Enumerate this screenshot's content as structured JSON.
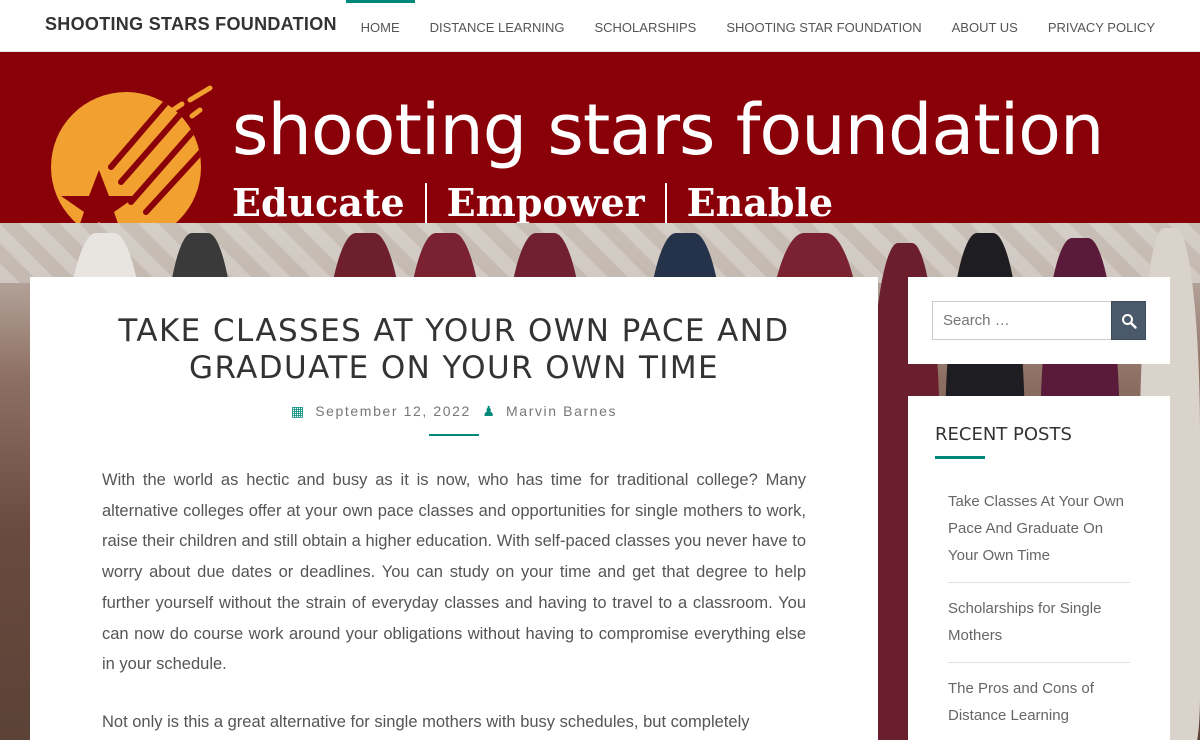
{
  "site": {
    "title": "SHOOTING STARS FOUNDATION"
  },
  "nav": {
    "items": [
      {
        "label": "HOME",
        "active": true
      },
      {
        "label": "DISTANCE LEARNING"
      },
      {
        "label": "SCHOLARSHIPS"
      },
      {
        "label": "SHOOTING STAR FOUNDATION"
      },
      {
        "label": "ABOUT US"
      },
      {
        "label": "PRIVACY POLICY"
      }
    ]
  },
  "banner": {
    "title": "shooting stars foundation",
    "tagline": [
      "Educate",
      "Empower",
      "Enable"
    ],
    "colors": {
      "background": "#8a0008",
      "logo": "#f2a030"
    }
  },
  "post": {
    "title": "TAKE CLASSES AT YOUR OWN PACE AND GRADUATE ON YOUR OWN TIME",
    "date": "September 12, 2022",
    "author": "Marvin Barnes",
    "paragraphs": [
      "With the world as hectic and busy as it is now, who has time for traditional college? Many alternative colleges offer at your own pace classes and opportunities for single mothers to work, raise their children and still obtain a higher education. With self-paced classes you never have to worry about due dates or deadlines. You can study on your time and get that degree to help further yourself without the strain of everyday classes and having to travel to a classroom. You can now do course work around your obligations without having to compromise everything else in your schedule.",
      "Not only is this a great alternative for single mothers with busy schedules, but completely"
    ]
  },
  "sidebar": {
    "search": {
      "placeholder": "Search …",
      "button_icon": "search-icon"
    },
    "recent_posts": {
      "heading": "RECENT POSTS",
      "items": [
        "Take Classes At Your Own Pace And Graduate On Your Own Time",
        "Scholarships for Single Mothers",
        "The Pros and Cons of Distance Learning"
      ]
    }
  },
  "colors": {
    "accent": "#00897b",
    "search_button": "#4a5a6a"
  }
}
